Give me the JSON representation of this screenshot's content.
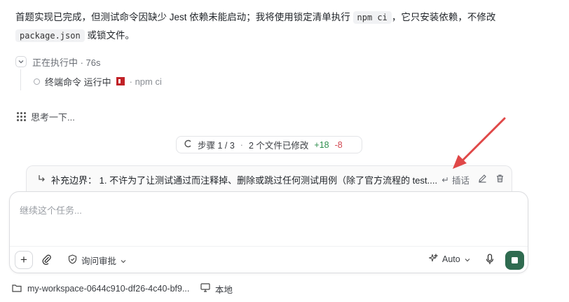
{
  "message": {
    "part1": "首题实现已完成，但测试命令因缺少 Jest 依赖未能启动；我将使用锁定清单执行 ",
    "code1": "npm ci",
    "part2": "，它只安装依赖，不修改",
    "code2": "package.json",
    "part3": " 或锁文件。"
  },
  "exec": {
    "label": "正在执行中 · 76s"
  },
  "terminal": {
    "label": "终端命令 运行中",
    "cmd": "· npm ci"
  },
  "thinking": {
    "label": "思考一下..."
  },
  "step": {
    "label": "步骤 1 / 3",
    "files": "2 个文件已修改",
    "added": "+18",
    "removed": "-8"
  },
  "queued": {
    "text": "补充边界： 1. 不许为了让测试通过而注释掉、删除或跳过任何测试用例（除了官方流程的 test....",
    "insert_label": "插话"
  },
  "composer": {
    "placeholder": "继续这个任务...",
    "approval_label": "询问审批",
    "model_label": "Auto"
  },
  "footer": {
    "workspace": "my-workspace-0644c910-df26-4c40-bf9...",
    "local": "本地"
  },
  "colors": {
    "accent": "#2f6b50",
    "added": "#2f8f4e",
    "removed": "#d1454f",
    "annotation_arrow": "#e04848"
  }
}
